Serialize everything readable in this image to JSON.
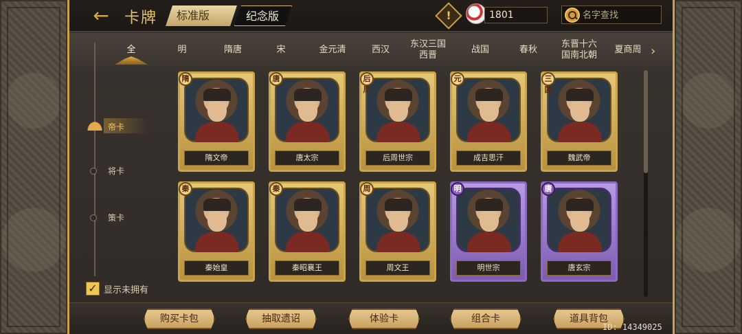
{
  "header": {
    "back_label": "←",
    "title": "卡牌",
    "version_tabs": [
      "标准版",
      "纪念版"
    ],
    "warning_icon": "!",
    "currency_amount": "1801",
    "search_placeholder": "名字查找"
  },
  "dynasty_tabs": [
    "全",
    "明",
    "隋唐",
    "宋",
    "金元清",
    "西汉",
    "东汉三国\n西晋",
    "战国",
    "春秋",
    "东晋十六\n国南北朝",
    "夏商周"
  ],
  "categories": {
    "items": [
      "帝卡",
      "将卡",
      "策卡"
    ],
    "active": "帝卡"
  },
  "show_unowned_label": "显示未拥有",
  "cards": [
    {
      "badge": "隋",
      "name": "隋文帝",
      "rarity": "gold"
    },
    {
      "badge": "唐",
      "name": "唐太宗",
      "rarity": "gold"
    },
    {
      "badge": "后周",
      "name": "后周世宗",
      "rarity": "gold"
    },
    {
      "badge": "元",
      "name": "成吉思汗",
      "rarity": "gold"
    },
    {
      "badge": "三国",
      "name": "魏武帝",
      "rarity": "gold"
    },
    {
      "badge": "秦",
      "name": "秦始皇",
      "rarity": "gold"
    },
    {
      "badge": "秦",
      "name": "秦昭襄王",
      "rarity": "gold"
    },
    {
      "badge": "周",
      "name": "周文王",
      "rarity": "gold"
    },
    {
      "badge": "明",
      "name": "明世宗",
      "rarity": "purple"
    },
    {
      "badge": "唐",
      "name": "唐玄宗",
      "rarity": "purple"
    }
  ],
  "bottom_buttons": [
    "购买卡包",
    "抽取遗诏",
    "体验卡",
    "组合卡",
    "道具背包"
  ],
  "uid": "ID: 14349025"
}
